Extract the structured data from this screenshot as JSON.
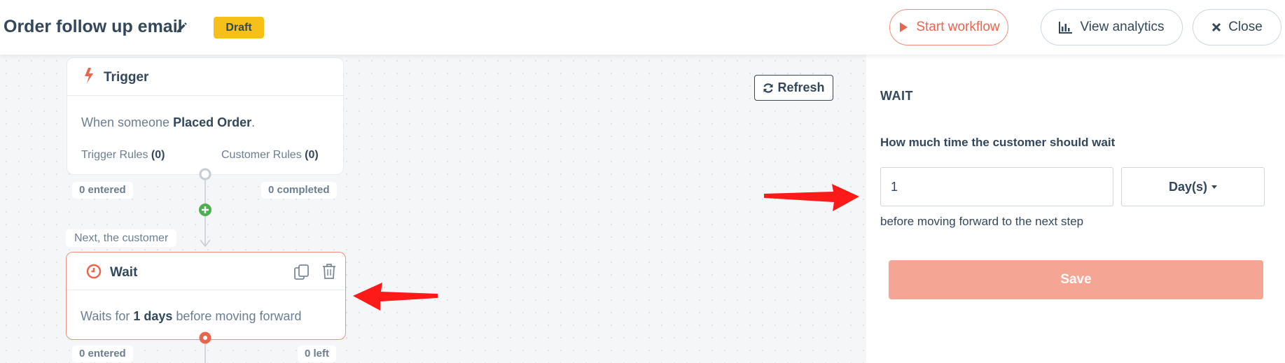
{
  "header": {
    "title": "Order follow up email",
    "badge": "Draft",
    "start_label": "Start workflow",
    "analytics_label": "View analytics",
    "close_label": "Close"
  },
  "canvas": {
    "refresh_label": "Refresh",
    "trigger": {
      "title": "Trigger",
      "text_prefix": "When someone ",
      "event": "Placed Order",
      "text_suffix": ".",
      "trigger_rules_label": "Trigger Rules",
      "trigger_rules_count": "(0)",
      "customer_rules_label": "Customer Rules",
      "customer_rules_count": "(0)",
      "entered": "0 entered",
      "completed": "0 completed"
    },
    "next_label": "Next, the customer",
    "wait": {
      "title": "Wait",
      "text_prefix": "Waits for ",
      "duration": "1 days",
      "text_suffix": " before moving forward",
      "entered": "0 entered",
      "left": "0 left"
    }
  },
  "panel": {
    "title": "WAIT",
    "label": "How much time the customer should wait",
    "value": "1",
    "unit": "Day(s)",
    "help": "before moving forward to the next step",
    "save_label": "Save"
  },
  "colors": {
    "accent": "#e8664e",
    "badge": "#f6c019",
    "save": "#f4a593",
    "add_node": "#4caf50",
    "arrow": "#ff1a1a"
  }
}
